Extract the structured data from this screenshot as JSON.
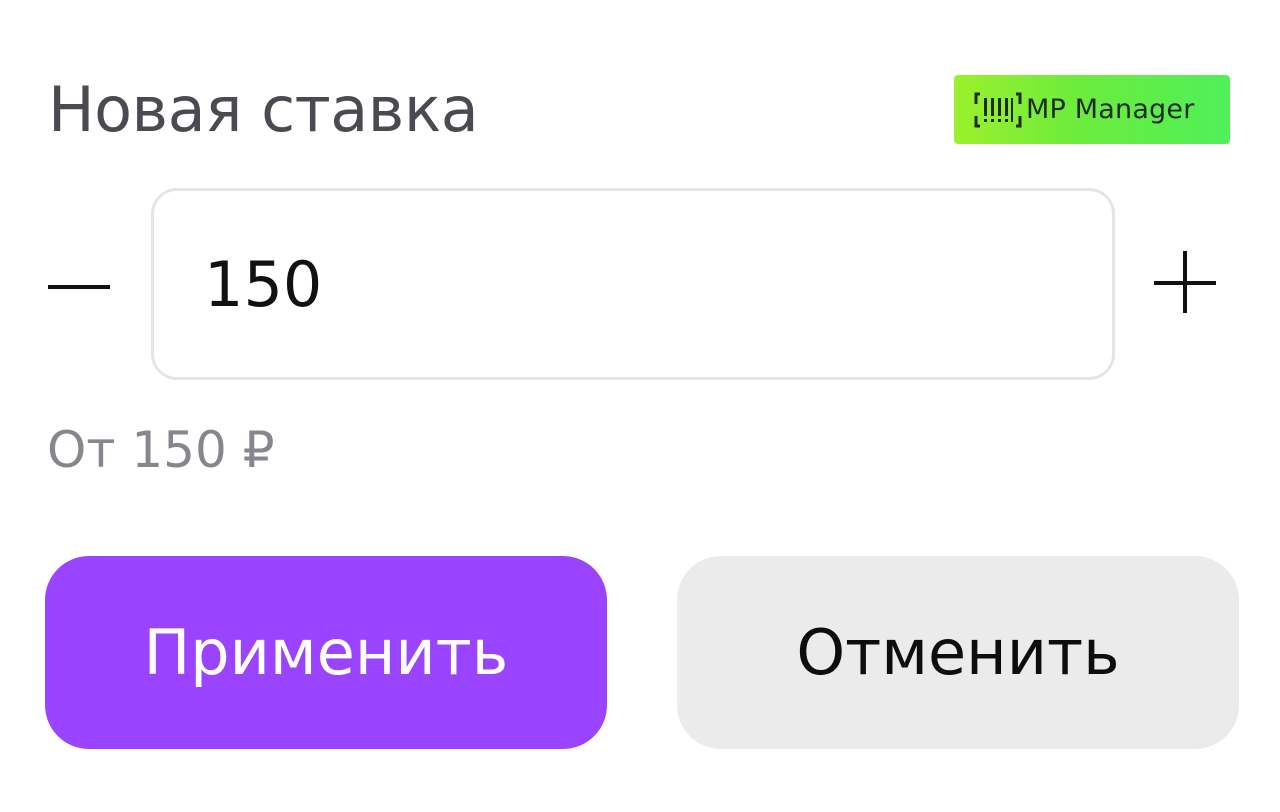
{
  "dialog": {
    "title": "Новая ставка"
  },
  "badge": {
    "label": "MP Manager",
    "icon": "barcode-icon",
    "colors": [
      "#9cf02c",
      "#4ff05a"
    ]
  },
  "bid": {
    "value": "150",
    "minus_icon": "minus-icon",
    "plus_icon": "plus-icon",
    "hint": "От 150 ₽"
  },
  "actions": {
    "apply_label": "Применить",
    "cancel_label": "Отменить",
    "apply_color": "#9a44ff",
    "cancel_color": "#ebebeb"
  }
}
